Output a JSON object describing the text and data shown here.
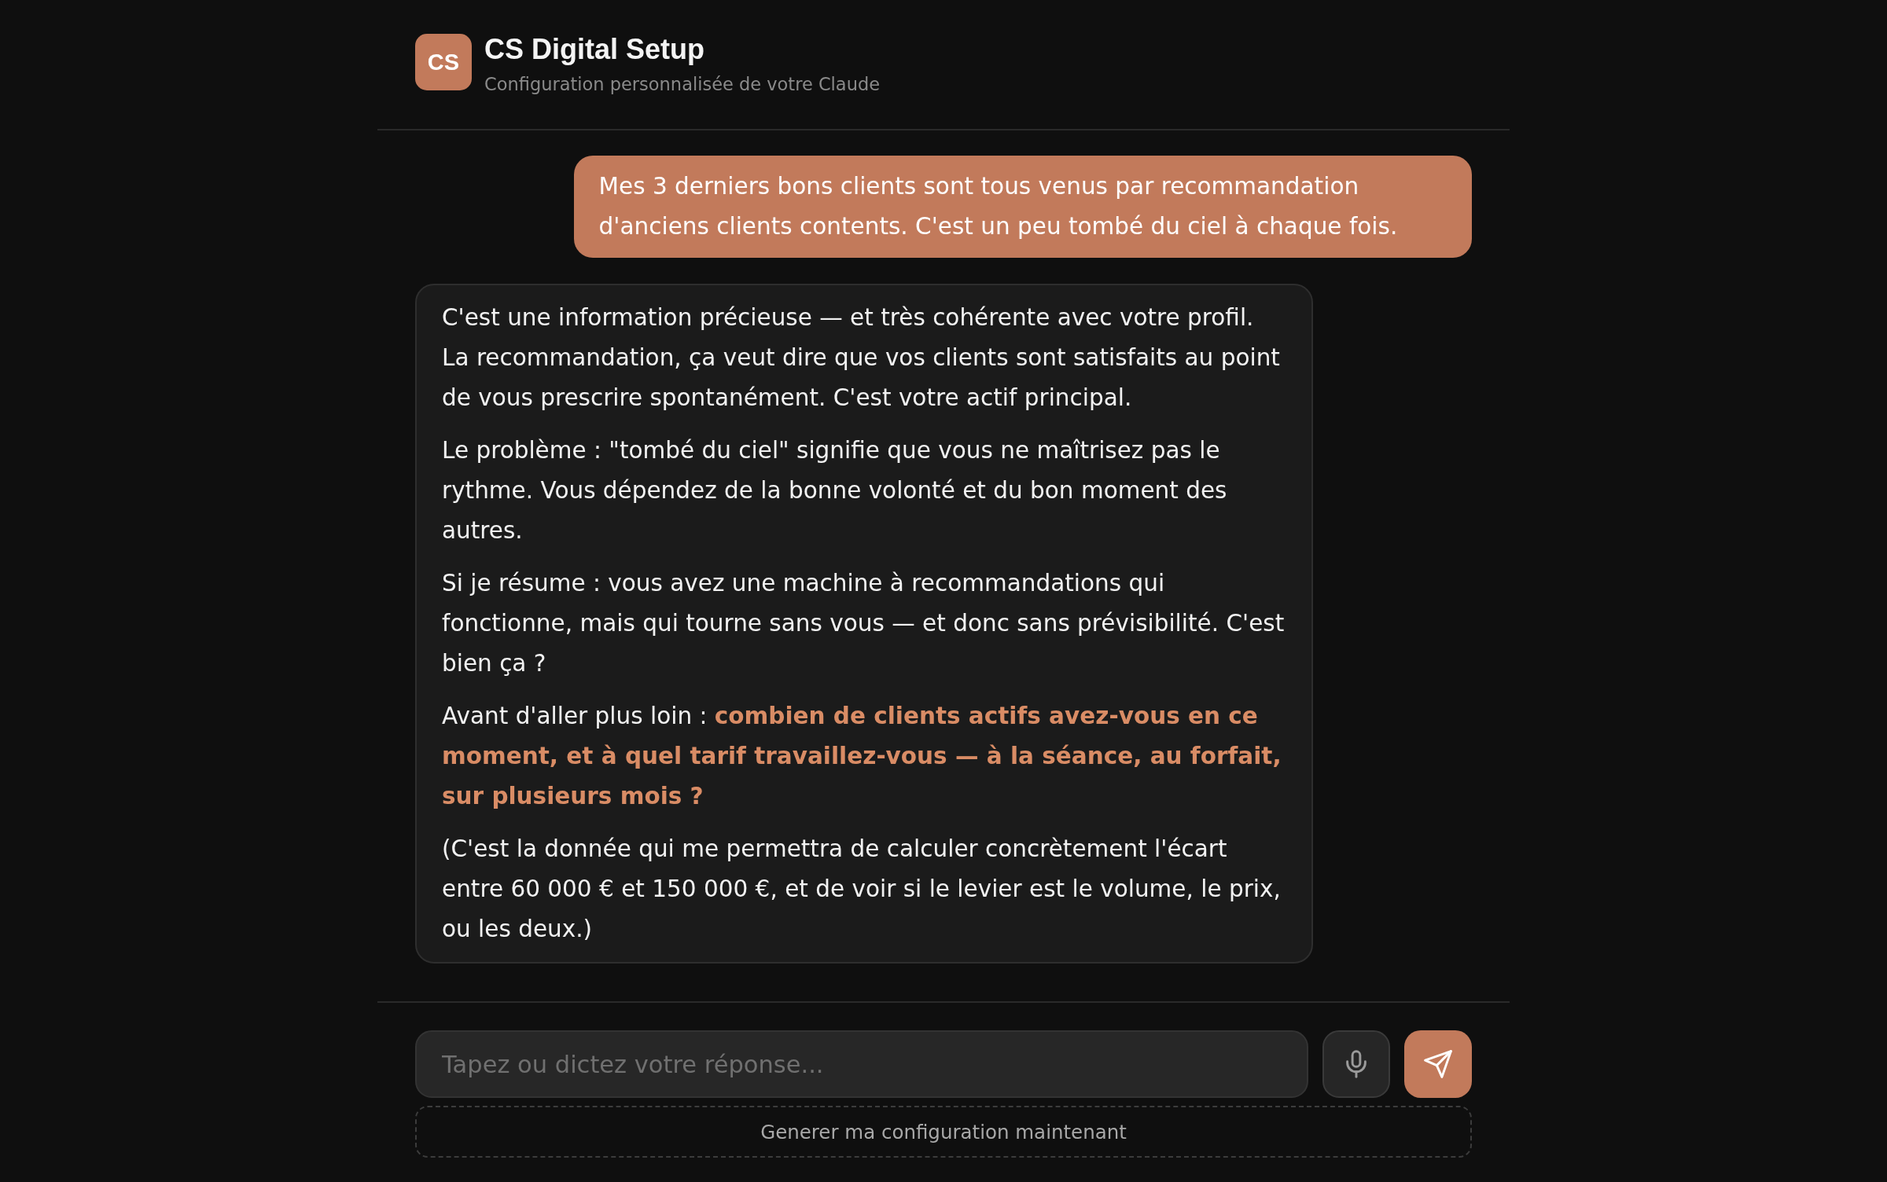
{
  "header": {
    "logo": "CS",
    "title": "CS Digital Setup",
    "subtitle": "Configuration personnalisée de votre Claude"
  },
  "messages": [
    {
      "kind": "user",
      "paragraphs": [
        "Mes 3 derniers bons clients sont tous venus par recommandation d'anciens clients contents. C'est un peu tombé du ciel à chaque fois."
      ]
    },
    {
      "kind": "assistant",
      "paragraphs": [
        "C'est une information précieuse — et très cohérente avec votre profil. La recommandation, ça veut dire que vos clients sont satisfaits au point de vous prescrire spontanément. C'est votre actif principal.",
        "Le problème : \"tombé du ciel\" signifie que vous ne maîtrisez pas le rythme. Vous dépendez de la bonne volonté et du bon moment des autres.",
        "Si je résume : vous avez une machine à recommandations qui fonctionne, mais qui tourne sans vous — et donc sans prévisibilité. C'est bien ça ?",
        "Avant d'aller plus loin : **combien de clients actifs avez-vous en ce moment, et à quel tarif travaillez-vous — à la séance, au forfait, sur plusieurs mois ?**",
        "(C'est la donnée qui me permettra de calculer concrètement l'écart entre 60 000 € et 150 000 €, et de voir si le levier est le volume, le prix, ou les deux.)"
      ]
    }
  ],
  "composer": {
    "placeholder": "Tapez ou dictez votre réponse...",
    "generate_button": "Generer ma configuration maintenant"
  }
}
